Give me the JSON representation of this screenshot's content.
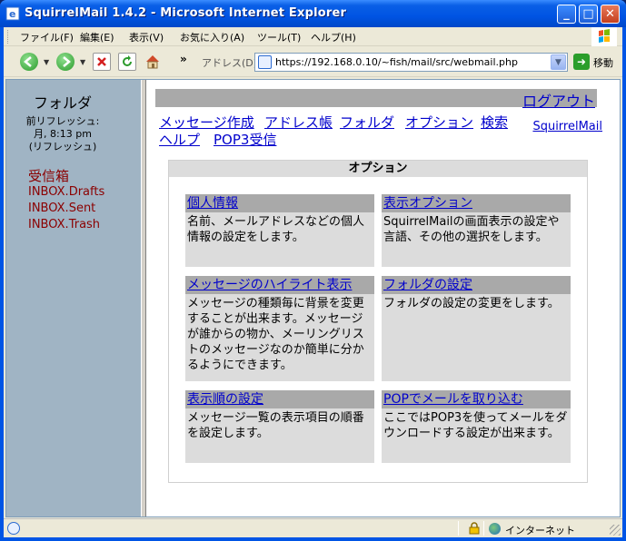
{
  "window": {
    "title": "SquirrelMail 1.4.2 - Microsoft Internet Explorer",
    "controls": {
      "minimize": "_",
      "maximize": "□",
      "close": "✕"
    }
  },
  "menubar": {
    "items": [
      "ファイル(F)",
      "編集(E)",
      "表示(V)",
      "お気に入り(A)",
      "ツール(T)",
      "ヘルプ(H)"
    ]
  },
  "toolbar": {
    "chevron": "»",
    "address_label": "アドレス(D)",
    "url": "https://192.168.0.10/~fish/mail/src/webmail.php",
    "go_label": "移動"
  },
  "sidebar": {
    "title": "フォルダ",
    "refresh_label": "前リフレッシュ:",
    "refresh_time": "月, 8:13 pm",
    "refresh_link": "(リフレッシュ)",
    "folders": [
      "受信箱",
      "INBOX.Drafts",
      "INBOX.Sent",
      "INBOX.Trash"
    ]
  },
  "main": {
    "logout": "ログアウト",
    "nav": [
      "メッセージ作成",
      "アドレス帳",
      "フォルダ",
      "オプション",
      "検索",
      "ヘルプ",
      "POP3受信"
    ],
    "squirrelmail_link": "SquirrelMail",
    "options_title": "オプション",
    "options": [
      {
        "title": "個人情報",
        "description": "名前、メールアドレスなどの個人情報の設定をします。"
      },
      {
        "title": "表示オプション",
        "description": "SquirrelMailの画面表示の設定や言語、その他の選択をします。"
      },
      {
        "title": "メッセージのハイライト表示",
        "description": "メッセージの種類毎に背景を変更することが出来ます。メッセージが誰からの物か、メーリングリストのメッセージなのか簡単に分かるようにできます。"
      },
      {
        "title": "フォルダの設定",
        "description": "フォルダの設定の変更をします。"
      },
      {
        "title": "表示順の設定",
        "description": "メッセージ一覧の表示項目の順番を設定します。"
      },
      {
        "title": "POPでメールを取り込む",
        "description": "ここではPOP3を使ってメールをダウンロードする設定が出来ます。"
      }
    ]
  },
  "statusbar": {
    "zone": "インターネット"
  }
}
